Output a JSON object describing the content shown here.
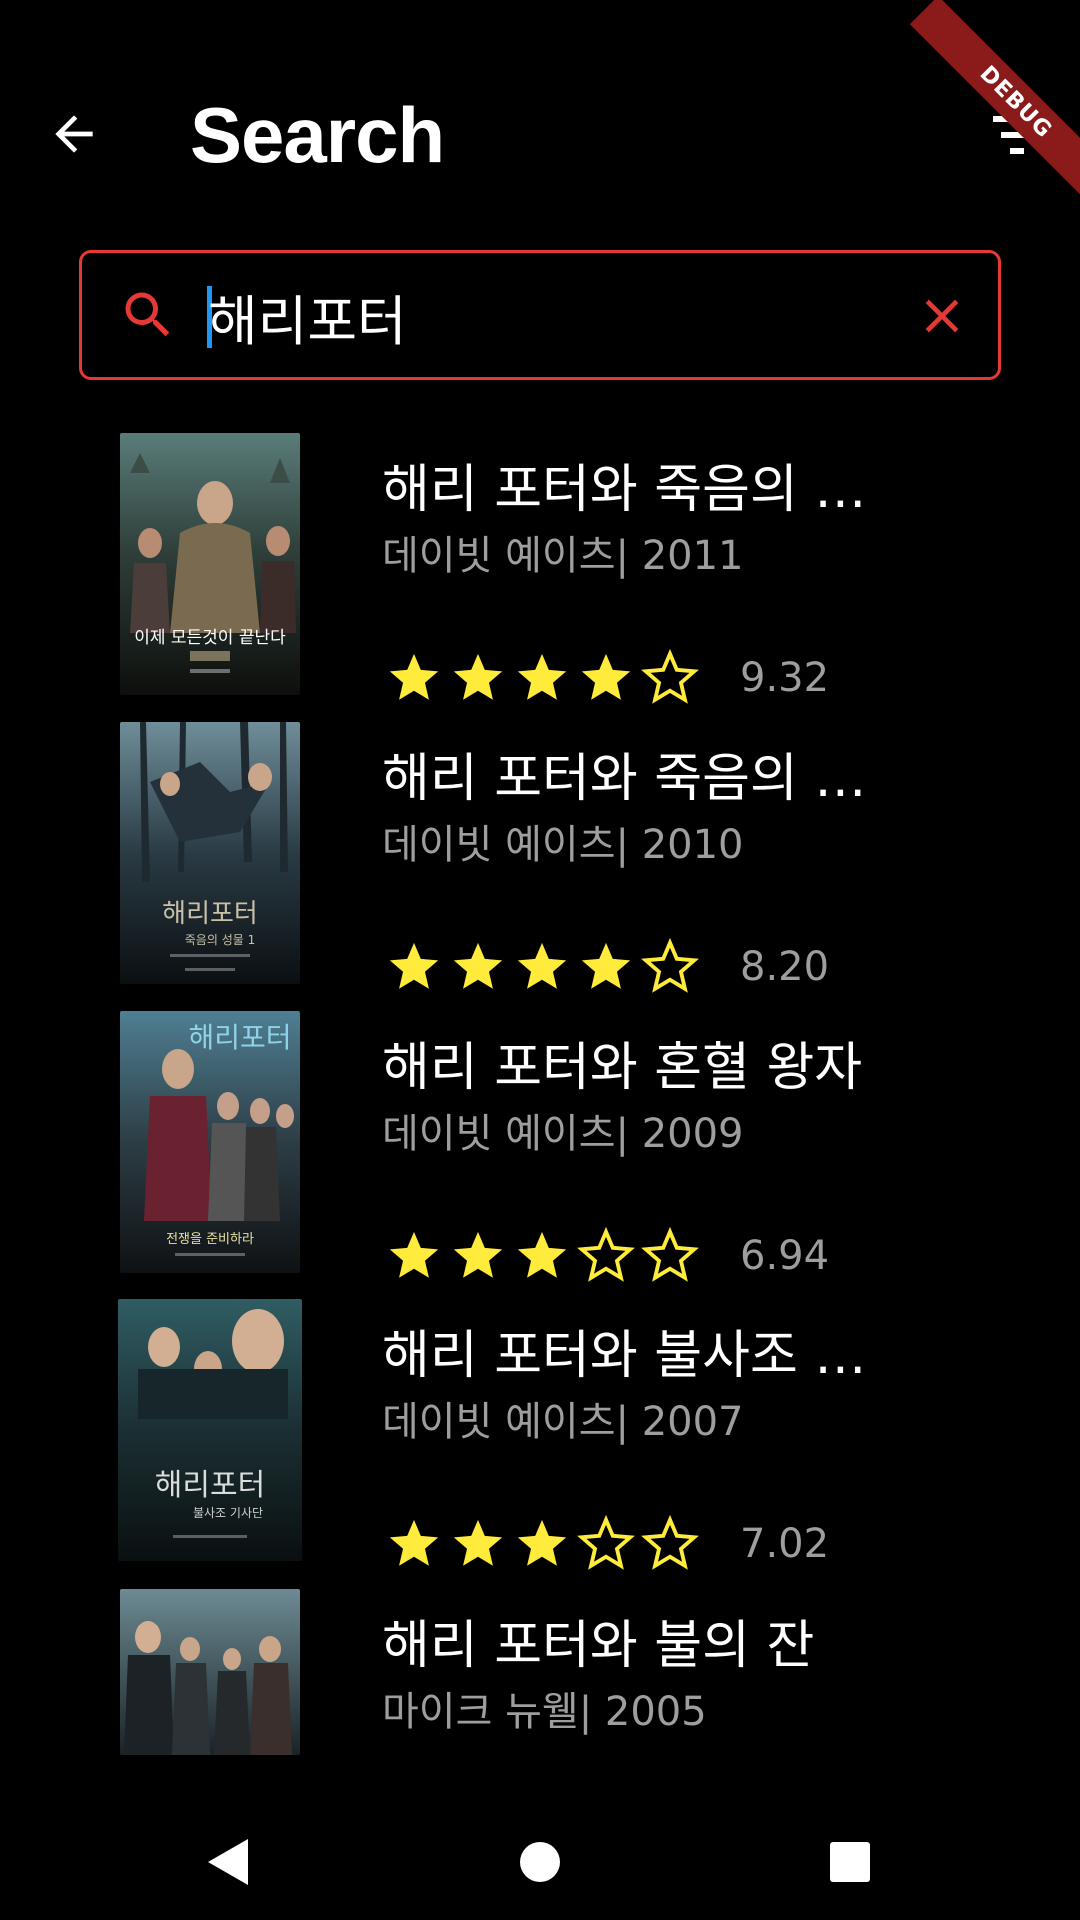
{
  "app_bar": {
    "title": "Search",
    "back_icon": "arrow-left-icon",
    "filter_icon": "filter-icon"
  },
  "debug_banner": "DEBUG",
  "search": {
    "value": "해리포터",
    "placeholder": "",
    "search_icon": "search-icon",
    "clear_icon": "close-icon"
  },
  "colors": {
    "accent": "#e53935",
    "caret": "#2196f3",
    "star": "#ffeb3b",
    "meta_text": "#9e9e9e",
    "background": "#000000"
  },
  "results": [
    {
      "title": "해리 포터와 죽음의 성...",
      "meta": "데이빗 예이츠| 2011",
      "rating": "9.32",
      "stars": 4,
      "poster_icon": "movie-poster-image"
    },
    {
      "title": "해리 포터와 죽음의 성...",
      "meta": "데이빗 예이츠| 2010",
      "rating": "8.20",
      "stars": 4,
      "poster_icon": "movie-poster-image"
    },
    {
      "title": "해리 포터와 혼혈 왕자",
      "meta": "데이빗 예이츠| 2009",
      "rating": "6.94",
      "stars": 3,
      "poster_icon": "movie-poster-image"
    },
    {
      "title": "해리 포터와 불사조 기...",
      "meta": "데이빗 예이츠| 2007",
      "rating": "7.02",
      "stars": 3,
      "poster_icon": "movie-poster-image"
    },
    {
      "title": "해리 포터와 불의 잔",
      "meta": "마이크 뉴웰| 2005",
      "rating": "",
      "stars": 0,
      "poster_icon": "movie-poster-image"
    }
  ],
  "poster_texts": {
    "p0_top": "",
    "p0_bottom": "이제 모든것이 끝난다",
    "p1_bottom": "해리포터",
    "p1_sub": "죽음의 성물 1",
    "p2_top": "해리포터",
    "p2_bottom": "전쟁을 준비하라",
    "p3_mid": "해리포터",
    "p3_sub": "불사조 기사단"
  },
  "nav_bar": {
    "back_icon": "nav-back-triangle-icon",
    "home_icon": "nav-home-circle-icon",
    "recents_icon": "nav-recents-square-icon"
  }
}
